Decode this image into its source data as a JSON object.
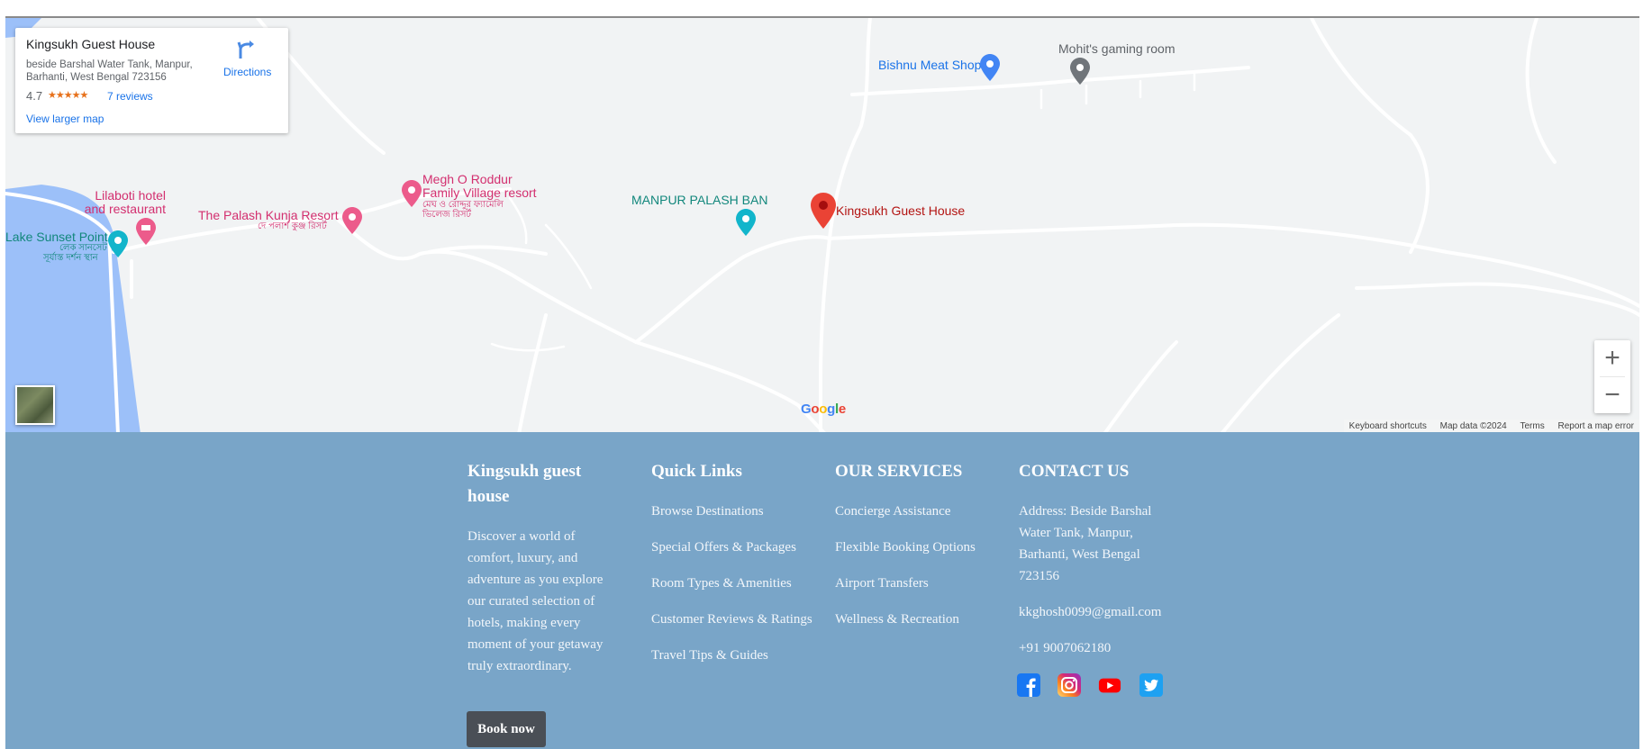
{
  "map": {
    "card": {
      "name": "Kingsukh Guest House",
      "address": "beside Barshal Water Tank, Manpur, Barhanti, West Bengal 723156",
      "rating": "4.7",
      "stars": "★★★★★",
      "reviews": "7 reviews",
      "view_larger": "View larger map",
      "directions": "Directions"
    },
    "labels": {
      "bishnu": "Bishnu Meat Shop",
      "mohit": "Mohit's gaming room",
      "megh_line1": "Megh O Roddur",
      "megh_line2": "Family Village resort",
      "megh_bn": "মেঘ ও রোদ্দুর ফ্যামেলি",
      "megh_bn2": "ভিলেজ রিসর্ট",
      "lilaboti_line1": "Lilaboti hotel",
      "lilaboti_line2": "and restaurant",
      "palash": "The Palash Kunja Resort",
      "palash_bn": "দে পলাশ কুঞ্জ রিসর্ট",
      "lake": "Lake Sunset Point",
      "lake_bn1": "লেক সানসেট",
      "lake_bn2": "সূর্যাস্ত দর্শন স্থান",
      "manpur": "MANPUR PALASH BAN",
      "kingsukh": "Kingsukh Guest House"
    },
    "zoom_in": "+",
    "zoom_out": "−",
    "google": "Google",
    "attribution": {
      "shortcuts": "Keyboard shortcuts",
      "data": "Map data ©2024",
      "terms": "Terms",
      "report": "Report a map error"
    },
    "colors": {
      "background": "#f1f3f4",
      "water": "#9cc0f9",
      "road": "#ffffff"
    }
  },
  "footer": {
    "about": {
      "title": "Kingsukh guest house",
      "description": "Discover a world of comfort, luxury, and adventure as you explore our curated selection of hotels, making every moment of your getaway truly extraordinary.",
      "button": "Book now"
    },
    "quick_links": {
      "title": "Quick Links",
      "items": [
        "Browse Destinations",
        "Special Offers & Packages",
        "Room Types & Amenities",
        "Customer Reviews & Ratings",
        "Travel Tips & Guides"
      ]
    },
    "services": {
      "title": "OUR SERVICES",
      "items": [
        "Concierge Assistance",
        "Flexible Booking Options",
        "Airport Transfers",
        "Wellness & Recreation"
      ]
    },
    "contact": {
      "title": "CONTACT US",
      "address": "Address: Beside Barshal Water Tank, Manpur, Barhanti, West Bengal 723156",
      "email": "kkghosh0099@gmail.com",
      "phone": "+91 9007062180",
      "socials": [
        "facebook-icon",
        "instagram-icon",
        "youtube-icon",
        "twitter-icon"
      ]
    },
    "colors": {
      "background": "#79a5c8",
      "button": "#4a4f56"
    }
  }
}
